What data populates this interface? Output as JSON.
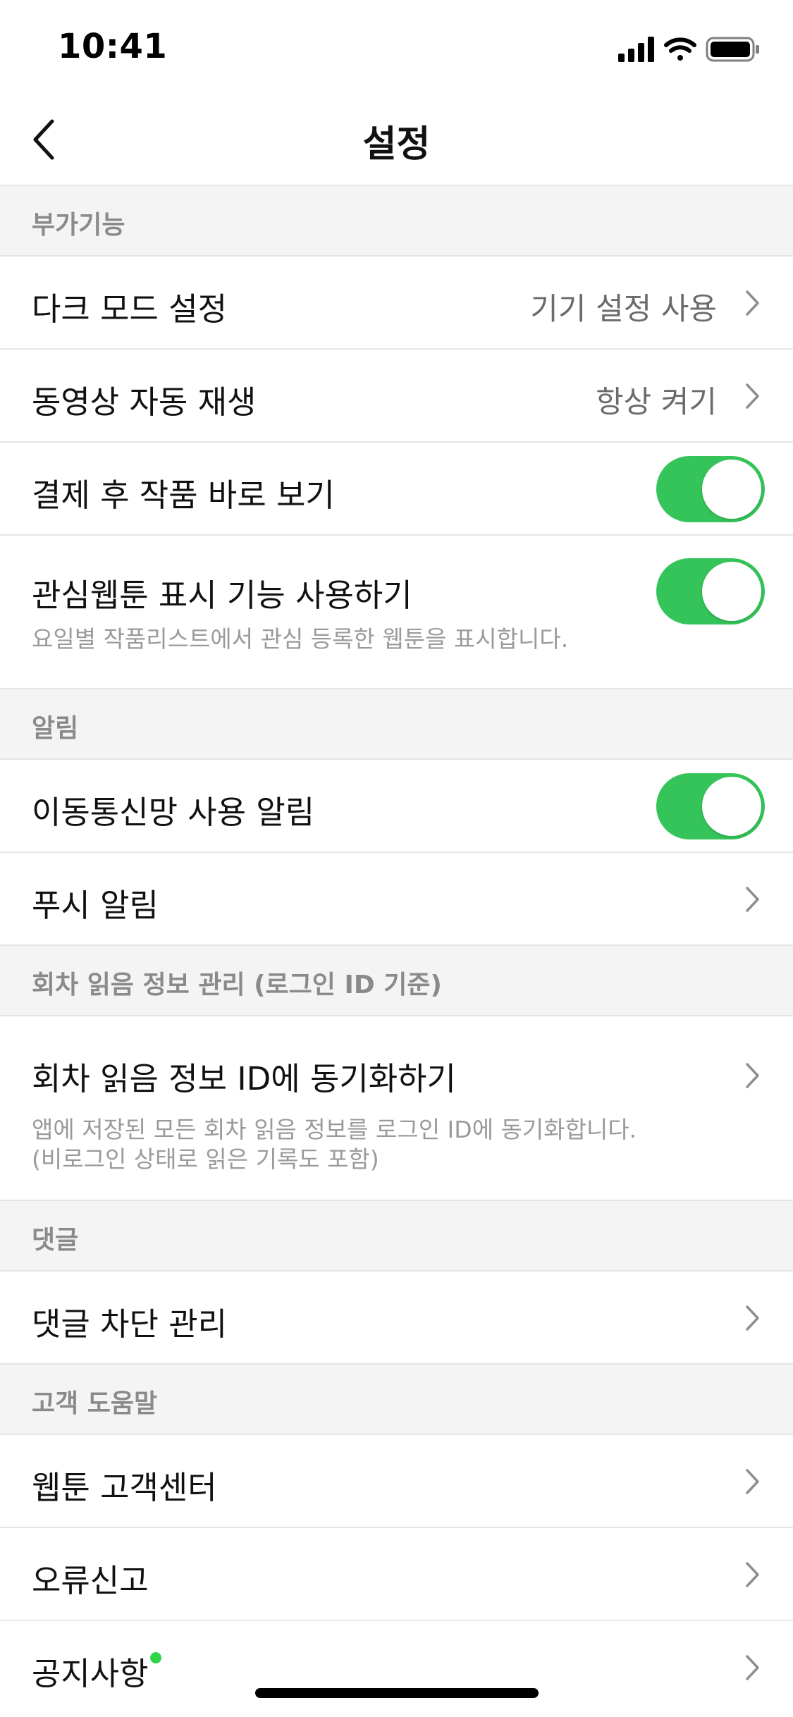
{
  "status_bar": {
    "time": "10:41",
    "icons": [
      "cellular-signal-icon",
      "wifi-icon",
      "battery-icon"
    ]
  },
  "nav": {
    "title": "설정",
    "back_icon": "chevron-left-icon"
  },
  "colors": {
    "toggle_on": "#35c45a",
    "section_bg": "#f4f4f4",
    "new_dot": "#2ed44a"
  },
  "sections": {
    "extras": {
      "header": "부가기능",
      "dark_mode": {
        "label": "다크 모드 설정",
        "value": "기기 설정 사용"
      },
      "autoplay": {
        "label": "동영상 자동 재생",
        "value": "항상 켜기"
      },
      "view_after_pay": {
        "label": "결제 후 작품 바로 보기",
        "toggle": true
      },
      "favorite_display": {
        "label": "관심웹툰 표시 기능 사용하기",
        "description": "요일별 작품리스트에서 관심 등록한 웹툰을 표시합니다.",
        "toggle": true
      }
    },
    "notifications": {
      "header": "알림",
      "mobile_data": {
        "label": "이동통신망 사용 알림",
        "toggle": true
      },
      "push": {
        "label": "푸시 알림"
      }
    },
    "reading_info": {
      "header": "회차 읽음 정보 관리 (로그인 ID 기준)",
      "sync": {
        "label": "회차 읽음 정보 ID에 동기화하기",
        "description_line1": "앱에 저장된 모든 회차 읽음 정보를 로그인 ID에 동기화합니다.",
        "description_line2": "(비로그인 상태로 읽은 기록도 포함)"
      }
    },
    "comments": {
      "header": "댓글",
      "block": {
        "label": "댓글 차단 관리"
      }
    },
    "help": {
      "header": "고객 도움말",
      "center": {
        "label": "웹툰 고객센터"
      },
      "report": {
        "label": "오류신고"
      },
      "notice": {
        "label": "공지사항",
        "has_new": true
      }
    }
  }
}
